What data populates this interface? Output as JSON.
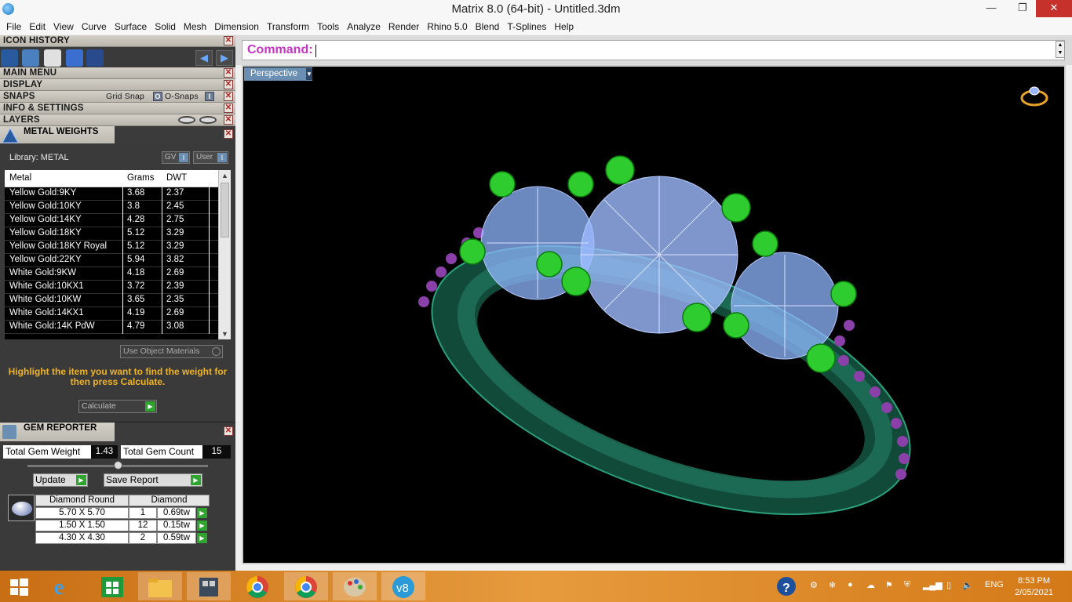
{
  "window": {
    "title": "Matrix 8.0 (64-bit) - Untitled.3dm",
    "min_glyph": "—",
    "max_glyph": "❐",
    "close_glyph": "✕"
  },
  "menu": [
    "File",
    "Edit",
    "View",
    "Curve",
    "Surface",
    "Solid",
    "Mesh",
    "Dimension",
    "Transform",
    "Tools",
    "Analyze",
    "Render",
    "Rhino 5.0",
    "Blend",
    "T-Splines",
    "Help"
  ],
  "panels": {
    "icon_history": "ICON HISTORY",
    "main_menu": "MAIN MENU",
    "display": "DISPLAY",
    "snaps": "SNAPS",
    "grid_snap": "Grid Snap",
    "o_snaps": "O-Snaps",
    "info_settings": "INFO & SETTINGS",
    "layers": "LAYERS",
    "close_glyph": "✕"
  },
  "metal_weights": {
    "title": "METAL WEIGHTS",
    "library": "Library: METAL",
    "gv": "GV",
    "user": "User",
    "columns": [
      "Metal",
      "Grams",
      "DWT"
    ],
    "rows": [
      [
        "Yellow Gold:9KY",
        "3.68",
        "2.37"
      ],
      [
        "Yellow Gold:10KY",
        "3.8",
        "2.45"
      ],
      [
        "Yellow Gold:14KY",
        "4.28",
        "2.75"
      ],
      [
        "Yellow Gold:18KY",
        "5.12",
        "3.29"
      ],
      [
        "Yellow Gold:18KY Royal",
        "5.12",
        "3.29"
      ],
      [
        "Yellow Gold:22KY",
        "5.94",
        "3.82"
      ],
      [
        "White Gold:9KW",
        "4.18",
        "2.69"
      ],
      [
        "White Gold:10KX1",
        "3.72",
        "2.39"
      ],
      [
        "White Gold:10KW",
        "3.65",
        "2.35"
      ],
      [
        "White Gold:14KX1",
        "4.19",
        "2.69"
      ],
      [
        "White Gold:14K PdW",
        "4.79",
        "3.08"
      ]
    ],
    "use_object_materials": "Use Object Materials",
    "hint": "Highlight the item you want to find the weight for then press Calculate.",
    "calculate": "Calculate"
  },
  "gem_reporter": {
    "title": "GEM REPORTER",
    "total_weight_label": "Total Gem Weight",
    "total_weight": "1.43",
    "total_count_label": "Total Gem Count",
    "total_count": "15",
    "update": "Update",
    "save_report": "Save Report",
    "shape": "Diamond Round",
    "material": "Diamond",
    "rows": [
      [
        "5.70 X 5.70",
        "1",
        "0.69tw"
      ],
      [
        "1.50 X 1.50",
        "12",
        "0.15tw"
      ],
      [
        "4.30 X 4.30",
        "2",
        "0.59tw"
      ]
    ]
  },
  "command": {
    "label": "Command:"
  },
  "viewport": {
    "name": "Perspective"
  },
  "taskbar": {
    "language": "ENG",
    "time": "8:53 PM",
    "date": "2/05/2021"
  },
  "colors": {
    "accent": "#6a8fb3",
    "metal": "#1f6e58",
    "prongs": "#2ecc2e",
    "stones": "#8fb6ff",
    "melee": "#8b3fa8",
    "command_label": "#c535c5",
    "hint": "#f0b326"
  }
}
